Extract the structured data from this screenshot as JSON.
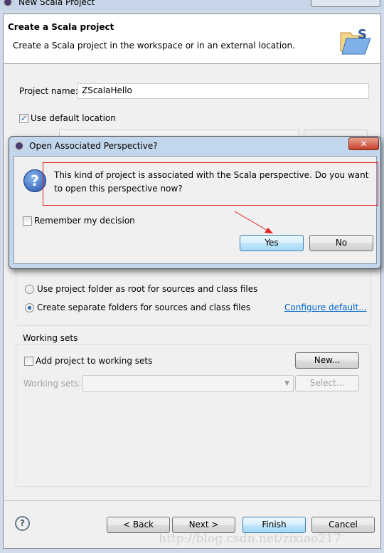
{
  "window": {
    "title": "New Scala Project"
  },
  "header": {
    "title": "Create a Scala project",
    "subtitle": "Create a Scala project in the workspace or in an external location."
  },
  "form": {
    "project_name_label": "Project name:",
    "project_name_value": "ZScalaHello",
    "use_default_location_label": "Use default location",
    "use_default_location_checked": true
  },
  "layout_group": {
    "option1": "Use project folder as root for sources and class files",
    "option2": "Create separate folders for sources and class files",
    "selected": 2,
    "configure_link": "Configure default..."
  },
  "working_sets": {
    "title": "Working sets",
    "add_label": "Add project to working sets",
    "add_checked": false,
    "new_button": "New...",
    "sets_label": "Working sets:",
    "select_button": "Select..."
  },
  "footer": {
    "back": "< Back",
    "next": "Next >",
    "finish": "Finish",
    "cancel": "Cancel"
  },
  "dialog": {
    "title": "Open Associated Perspective?",
    "message": "This kind of project is associated with the Scala perspective.  Do you want to open this perspective now?",
    "remember_label": "Remember my decision",
    "yes": "Yes",
    "no": "No"
  },
  "watermark": "http://blog.csdn.net/zixiao217",
  "colors": {
    "annotation_red": "#e02020",
    "link": "#0066cc"
  }
}
